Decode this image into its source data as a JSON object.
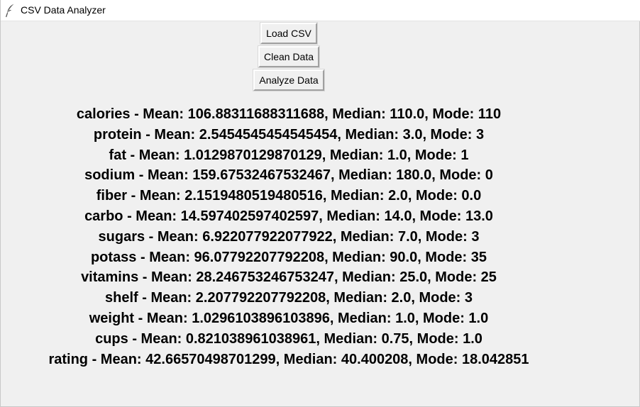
{
  "window": {
    "title": "CSV Data Analyzer",
    "icon": "feather-icon"
  },
  "buttons": {
    "load": "Load CSV",
    "clean": "Clean Data",
    "analyze": "Analyze Data"
  },
  "results": [
    "calories - Mean: 106.88311688311688, Median: 110.0, Mode: 110",
    "protein - Mean: 2.5454545454545454, Median: 3.0, Mode: 3",
    "fat - Mean: 1.0129870129870129, Median: 1.0, Mode: 1",
    "sodium - Mean: 159.67532467532467, Median: 180.0, Mode: 0",
    "fiber - Mean: 2.1519480519480516, Median: 2.0, Mode: 0.0",
    "carbo - Mean: 14.597402597402597, Median: 14.0, Mode: 13.0",
    "sugars - Mean: 6.922077922077922, Median: 7.0, Mode: 3",
    "potass - Mean: 96.07792207792208, Median: 90.0, Mode: 35",
    "vitamins - Mean: 28.246753246753247, Median: 25.0, Mode: 25",
    "shelf - Mean: 2.207792207792208, Median: 2.0, Mode: 3",
    "weight - Mean: 1.0296103896103896, Median: 1.0, Mode: 1.0",
    "cups - Mean: 0.821038961038961, Median: 0.75, Mode: 1.0",
    "rating - Mean: 42.66570498701299, Median: 40.400208, Mode: 18.042851"
  ]
}
